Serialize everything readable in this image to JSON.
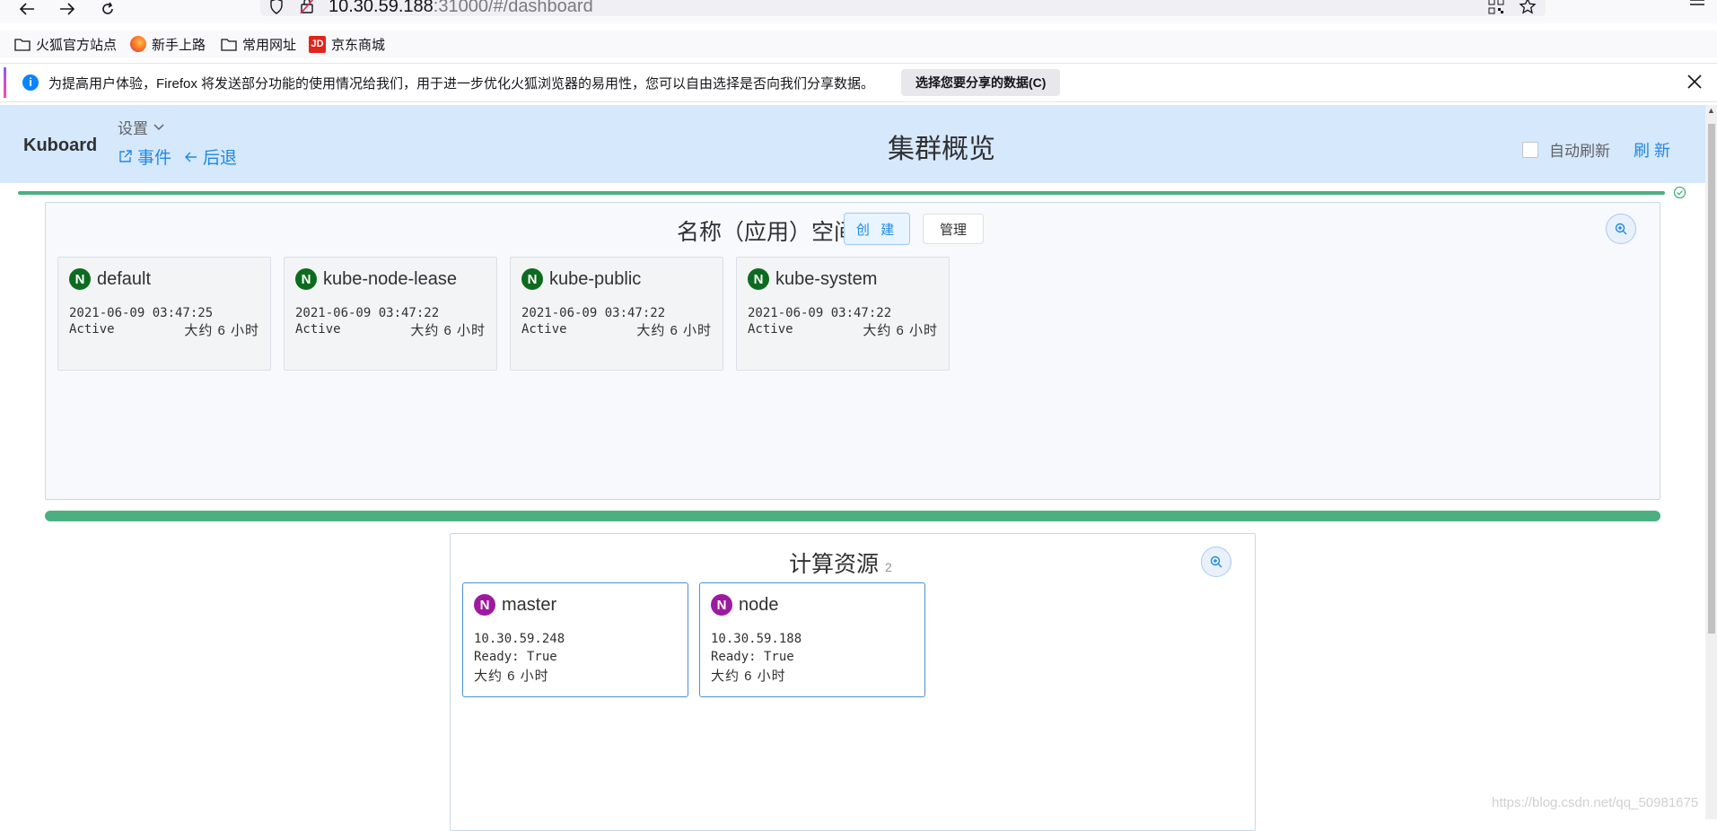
{
  "browser": {
    "url_host": "10.30.59.188",
    "url_rest": ":31000/#/dashboard",
    "bookmarks": [
      {
        "label": "火狐官方站点",
        "icon": "folder-icon"
      },
      {
        "label": "新手上路",
        "icon": "firefox-icon"
      },
      {
        "label": "常用网址",
        "icon": "folder-icon"
      },
      {
        "label": "京东商城",
        "icon": "jd-icon"
      }
    ],
    "notice": {
      "text": "为提高用户体验，Firefox 将发送部分功能的使用情况给我们，用于进一步优化火狐浏览器的易用性，您可以自由选择是否向我们分享数据。",
      "button": "选择您要分享的数据(C)"
    }
  },
  "header": {
    "logo": "Kuboard",
    "settings": "设置",
    "events": "事件",
    "back": "后退",
    "title": "集群概览",
    "auto_refresh": "自动刷新",
    "refresh": "刷 新"
  },
  "namespaces": {
    "title": "名称（应用）空间",
    "create": "创 建",
    "manage": "管理",
    "badge": "N",
    "items": [
      {
        "name": "default",
        "created": "2021-06-09 03:47:25",
        "status": "Active",
        "age": "大约 6 小时"
      },
      {
        "name": "kube-node-lease",
        "created": "2021-06-09 03:47:22",
        "status": "Active",
        "age": "大约 6 小时"
      },
      {
        "name": "kube-public",
        "created": "2021-06-09 03:47:22",
        "status": "Active",
        "age": "大约 6 小时"
      },
      {
        "name": "kube-system",
        "created": "2021-06-09 03:47:22",
        "status": "Active",
        "age": "大约 6 小时"
      }
    ]
  },
  "compute": {
    "title": "计算资源",
    "count": "2",
    "badge": "N",
    "items": [
      {
        "name": "master",
        "ip": "10.30.59.248",
        "ready": "Ready: True",
        "age": "大约 6 小时"
      },
      {
        "name": "node",
        "ip": "10.30.59.188",
        "ready": "Ready: True",
        "age": "大约 6 小时"
      }
    ]
  },
  "watermark": "https://blog.csdn.net/qq_50981675",
  "colors": {
    "header_bg": "#d6e8fb",
    "accent": "#1e88e5",
    "progress": "#4caf80",
    "ns_badge": "#0d6b1f",
    "node_badge": "#9c1aa0"
  }
}
